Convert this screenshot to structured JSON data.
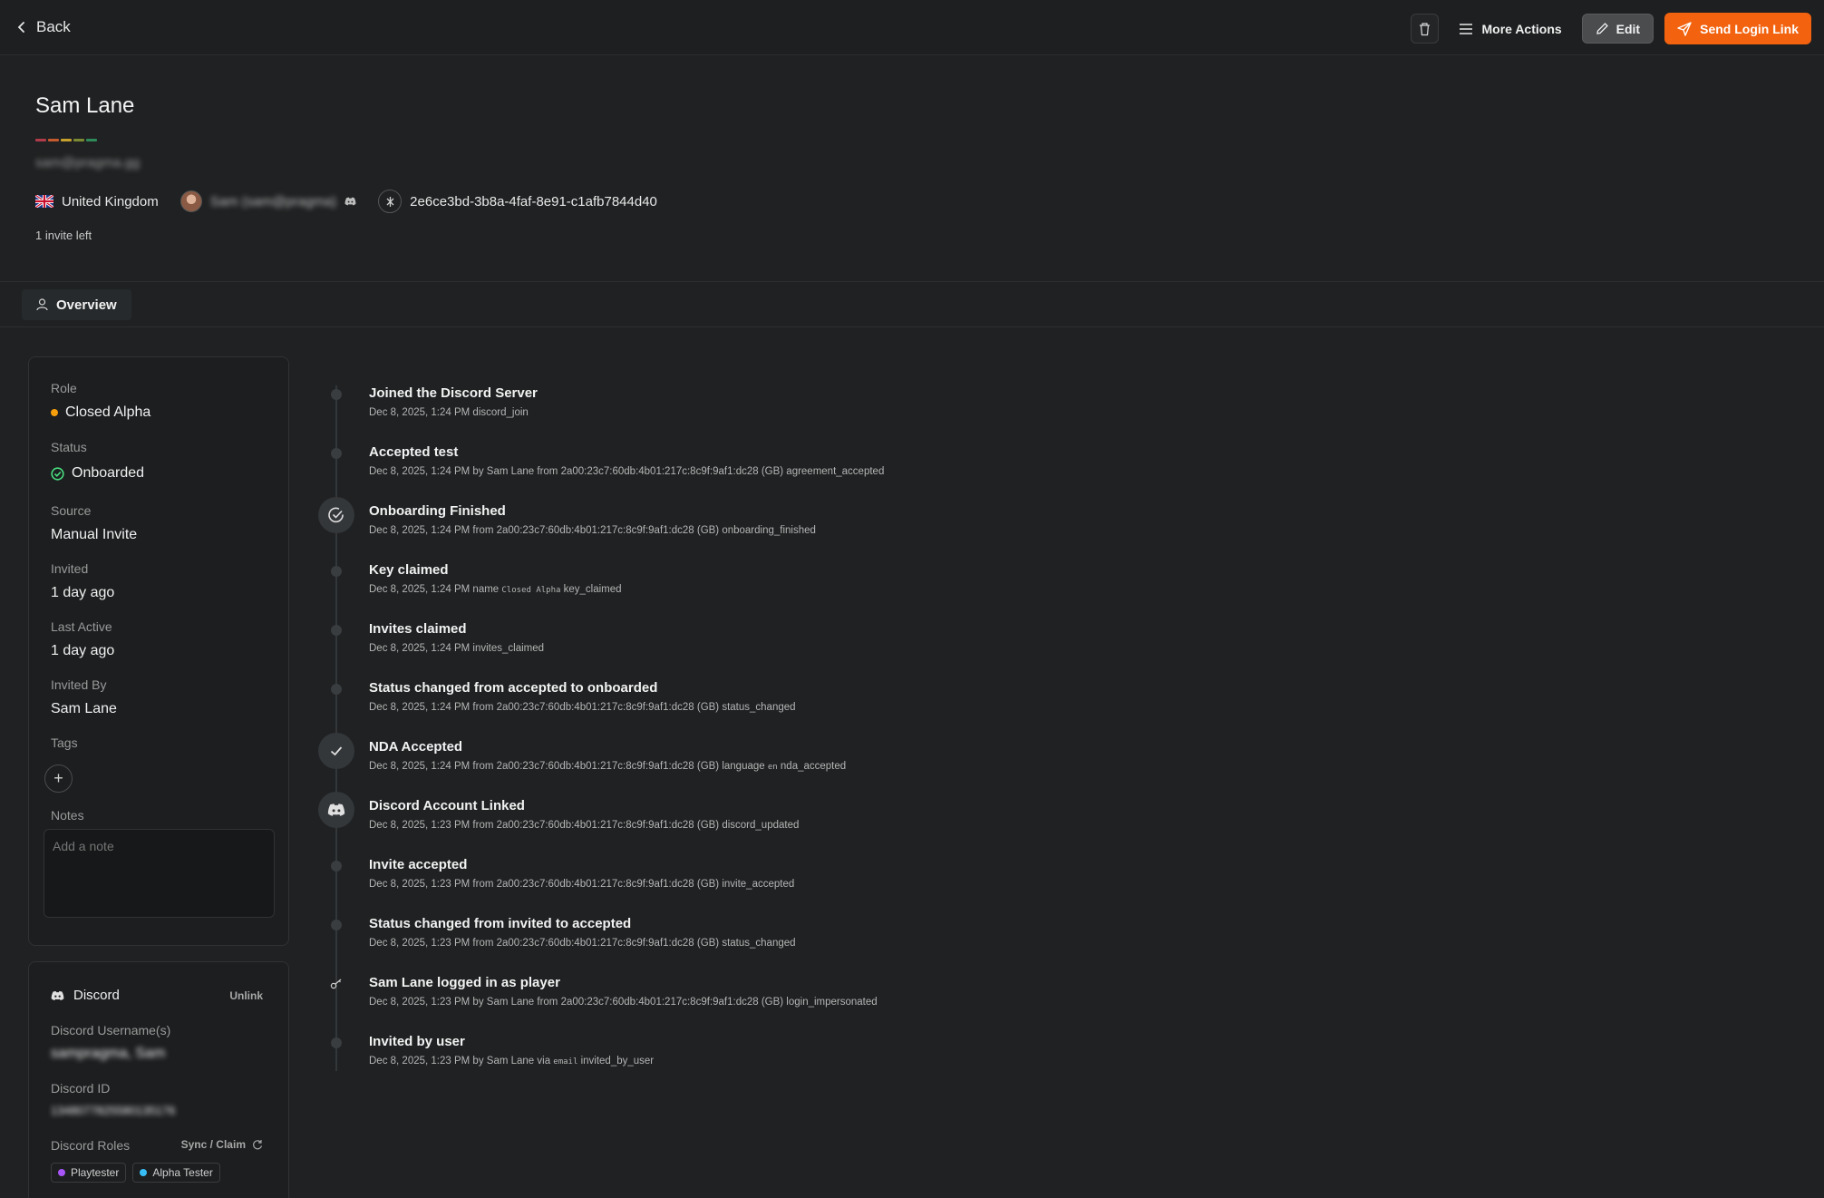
{
  "topbar": {
    "back_label": "Back",
    "more_actions_label": "More Actions",
    "edit_label": "Edit",
    "send_login_link_label": "Send Login Link"
  },
  "profile": {
    "name": "Sam Lane",
    "email": "sam@pragma.gg",
    "country": "United Kingdom",
    "discord_display": "Sam (sam@pragma)",
    "player_id": "2e6ce3bd-3b8a-4faf-8e91-c1afb7844d40",
    "invites_left": "1 invite left",
    "colorbar": [
      "#b23b4a",
      "#c45a2e",
      "#c7a12e",
      "#7b8a33",
      "#2f8a5a"
    ]
  },
  "tabs": [
    {
      "label": "Overview",
      "icon": "user-icon"
    }
  ],
  "details": {
    "role_label": "Role",
    "role_value": "Closed Alpha",
    "role_color": "#f59e0b",
    "status_label": "Status",
    "status_value": "Onboarded",
    "status_color": "#4ade80",
    "source_label": "Source",
    "source_value": "Manual Invite",
    "invited_label": "Invited",
    "invited_value": "1 day ago",
    "last_active_label": "Last Active",
    "last_active_value": "1 day ago",
    "invited_by_label": "Invited By",
    "invited_by_value": "Sam Lane",
    "tags_label": "Tags",
    "notes_label": "Notes",
    "notes_placeholder": "Add a note"
  },
  "discord": {
    "title": "Discord",
    "unlink_label": "Unlink",
    "usernames_label": "Discord Username(s)",
    "usernames_value": "sampragma, Sam",
    "id_label": "Discord ID",
    "id_value": "1348077825580135176",
    "roles_label": "Discord Roles",
    "sync_label": "Sync / Claim",
    "roles": [
      {
        "name": "Playtester",
        "color": "#a855f7"
      },
      {
        "name": "Alpha Tester",
        "color": "#38bdf8"
      }
    ]
  },
  "timeline": [
    {
      "title": "Joined the Discord Server",
      "desc": "Dec 8, 2025, 1:24 PM discord_join",
      "node": "dot"
    },
    {
      "title": "Accepted test",
      "desc": "Dec 8, 2025, 1:24 PM by Sam Lane from 2a00:23c7:60db:4b01:217c:8c9f:9af1:dc28 (GB) agreement_accepted",
      "node": "dot"
    },
    {
      "title": "Onboarding Finished",
      "desc": "Dec 8, 2025, 1:24 PM from 2a00:23c7:60db:4b01:217c:8c9f:9af1:dc28 (GB) onboarding_finished",
      "node": "check-circle"
    },
    {
      "title": "Key claimed",
      "desc_pre": "Dec 8, 2025, 1:24 PM name ",
      "desc_mono": "Closed Alpha",
      "desc_post": " key_claimed",
      "node": "dot"
    },
    {
      "title": "Invites claimed",
      "desc": "Dec 8, 2025, 1:24 PM invites_claimed",
      "node": "dot"
    },
    {
      "title": "Status changed from accepted to onboarded",
      "desc": "Dec 8, 2025, 1:24 PM from 2a00:23c7:60db:4b01:217c:8c9f:9af1:dc28 (GB) status_changed",
      "node": "dot"
    },
    {
      "title": "NDA Accepted",
      "desc_pre": "Dec 8, 2025, 1:24 PM from 2a00:23c7:60db:4b01:217c:8c9f:9af1:dc28 (GB) language ",
      "desc_mono": "en",
      "desc_post": " nda_accepted",
      "node": "check"
    },
    {
      "title": "Discord Account Linked",
      "desc": "Dec 8, 2025, 1:23 PM from 2a00:23c7:60db:4b01:217c:8c9f:9af1:dc28 (GB) discord_updated",
      "node": "discord"
    },
    {
      "title": "Invite accepted",
      "desc": "Dec 8, 2025, 1:23 PM from 2a00:23c7:60db:4b01:217c:8c9f:9af1:dc28 (GB) invite_accepted",
      "node": "dot"
    },
    {
      "title": "Status changed from invited to accepted",
      "desc": "Dec 8, 2025, 1:23 PM from 2a00:23c7:60db:4b01:217c:8c9f:9af1:dc28 (GB) status_changed",
      "node": "dot"
    },
    {
      "title": "Sam Lane logged in as player",
      "desc": "Dec 8, 2025, 1:23 PM by Sam Lane from 2a00:23c7:60db:4b01:217c:8c9f:9af1:dc28 (GB) login_impersonated",
      "node": "key"
    },
    {
      "title": "Invited by user",
      "desc_pre": "Dec 8, 2025, 1:23 PM by Sam Lane via ",
      "desc_mono": "email",
      "desc_post": " invited_by_user",
      "node": "dot"
    }
  ]
}
